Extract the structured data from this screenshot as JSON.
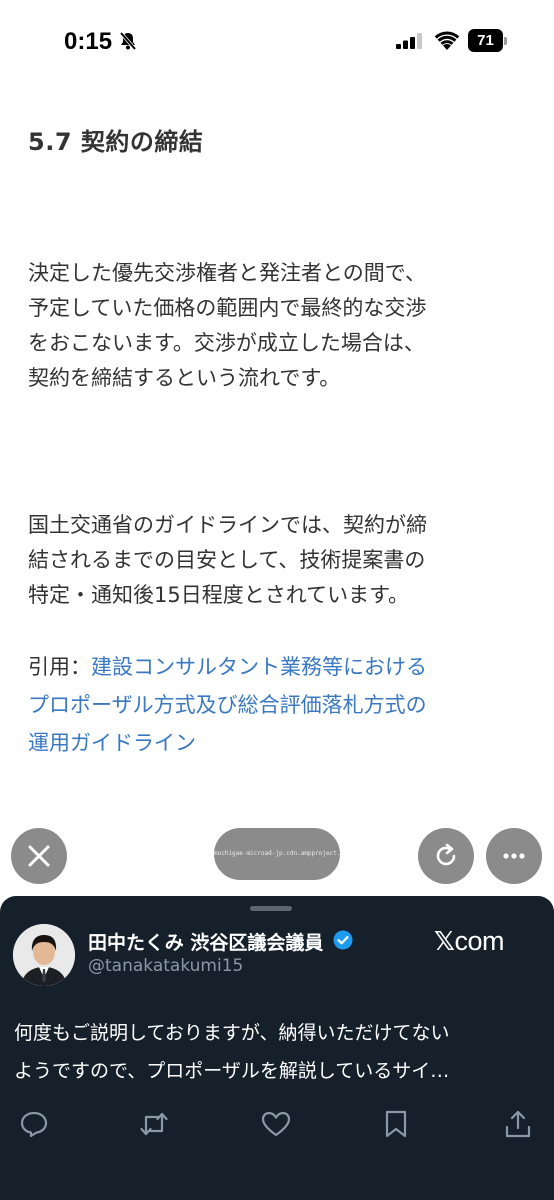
{
  "status_bar": {
    "time": "0:15",
    "battery": "71"
  },
  "article": {
    "heading": "5.7 契約の締結",
    "paragraph_1": [
      "決定した優先交渉権者と発注者との間で、",
      "予定していた価格の範囲内で最終的な交渉",
      "をおこないます。交渉が成立した場合は、",
      "契約を締結するという流れです。"
    ],
    "paragraph_2": [
      "国土交通省のガイドラインでは、契約が締",
      "結されるまでの目安として、技術提案書の",
      "特定・通知後15日程度とされています。"
    ],
    "citation_prefix": "引用：",
    "citation_link": [
      "建設コンサルタント業務等における",
      "プロポーザル方式及び総合評価落札方式の",
      "運用ガイドライン"
    ]
  },
  "browser_controls": {
    "url": "mochigae-microad-jp.cdn.ampproject.org"
  },
  "tweet": {
    "display_name": "田中たくみ 渋谷区議会議員",
    "handle": "@tanakatakumi15",
    "source": "com",
    "text_lines": [
      "何度もご説明しておりますが、納得いただけてない",
      "ようですので、プロポーザルを解説しているサイ…"
    ]
  },
  "colors": {
    "link": "#3a78c2",
    "card_background": "#15202b",
    "verified": "#1d9bf0"
  }
}
